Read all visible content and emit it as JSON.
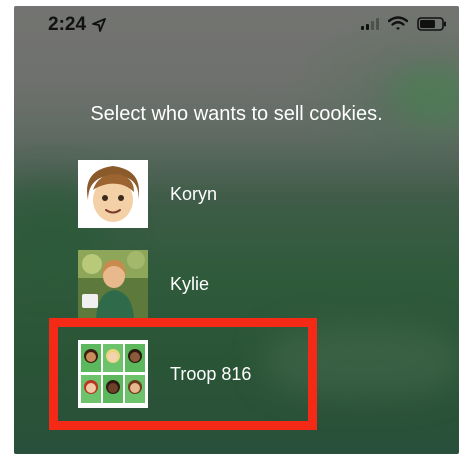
{
  "status_bar": {
    "time": "2:24"
  },
  "prompt": "Select who wants to sell cookies.",
  "sellers": [
    {
      "name": "Koryn"
    },
    {
      "name": "Kylie"
    },
    {
      "name": "Troop 816"
    }
  ],
  "colors": {
    "highlight": "#f42a17",
    "text": "#ffffff"
  }
}
